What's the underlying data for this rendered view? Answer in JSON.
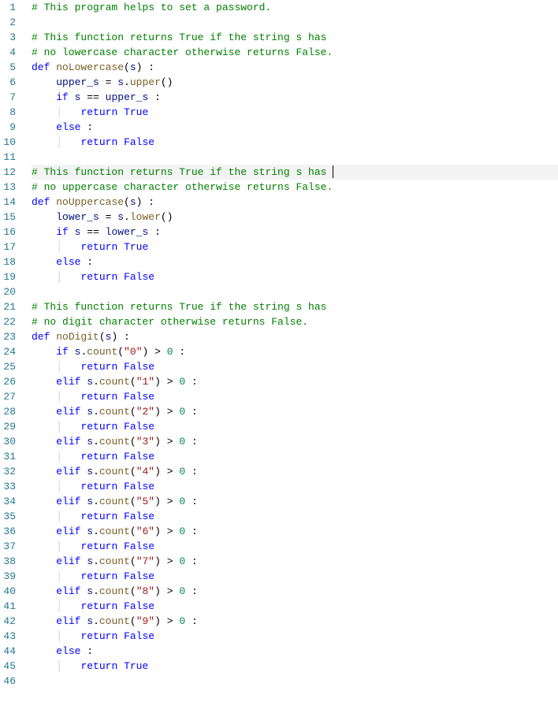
{
  "lines": [
    {
      "num": "1",
      "tokens": [
        {
          "t": "# This program helps to set a password.",
          "c": "comment"
        }
      ]
    },
    {
      "num": "2",
      "tokens": []
    },
    {
      "num": "3",
      "tokens": [
        {
          "t": "# This function returns True if the string s has",
          "c": "comment"
        }
      ]
    },
    {
      "num": "4",
      "tokens": [
        {
          "t": "# no lowercase character otherwise returns False.",
          "c": "comment"
        }
      ]
    },
    {
      "num": "5",
      "tokens": [
        {
          "t": "def ",
          "c": "keyword"
        },
        {
          "t": "noLowercase",
          "c": "funcdef"
        },
        {
          "t": "(",
          "c": ""
        },
        {
          "t": "s",
          "c": "ident"
        },
        {
          "t": ") :",
          "c": ""
        }
      ]
    },
    {
      "num": "6",
      "tokens": [
        {
          "t": "    ",
          "c": ""
        },
        {
          "t": "upper_s",
          "c": "ident"
        },
        {
          "t": " = ",
          "c": ""
        },
        {
          "t": "s",
          "c": "ident"
        },
        {
          "t": ".",
          "c": ""
        },
        {
          "t": "upper",
          "c": "funccall"
        },
        {
          "t": "()",
          "c": ""
        }
      ]
    },
    {
      "num": "7",
      "tokens": [
        {
          "t": "    ",
          "c": ""
        },
        {
          "t": "if",
          "c": "keyword"
        },
        {
          "t": " ",
          "c": ""
        },
        {
          "t": "s",
          "c": "ident"
        },
        {
          "t": " == ",
          "c": ""
        },
        {
          "t": "upper_s",
          "c": "ident"
        },
        {
          "t": " :",
          "c": ""
        }
      ]
    },
    {
      "num": "8",
      "tokens": [
        {
          "t": "    ",
          "c": ""
        },
        {
          "t": "│   ",
          "c": "guide"
        },
        {
          "t": "return",
          "c": "keyword"
        },
        {
          "t": " ",
          "c": ""
        },
        {
          "t": "True",
          "c": "const"
        }
      ]
    },
    {
      "num": "9",
      "tokens": [
        {
          "t": "    ",
          "c": ""
        },
        {
          "t": "else",
          "c": "keyword"
        },
        {
          "t": " :",
          "c": ""
        }
      ]
    },
    {
      "num": "10",
      "tokens": [
        {
          "t": "    ",
          "c": ""
        },
        {
          "t": "│   ",
          "c": "guide"
        },
        {
          "t": "return",
          "c": "keyword"
        },
        {
          "t": " ",
          "c": ""
        },
        {
          "t": "False",
          "c": "const"
        }
      ]
    },
    {
      "num": "11",
      "tokens": []
    },
    {
      "num": "12",
      "highlighted": true,
      "cursor": true,
      "tokens": [
        {
          "t": "# This function returns True if the string s has ",
          "c": "comment"
        }
      ]
    },
    {
      "num": "13",
      "tokens": [
        {
          "t": "# no uppercase character otherwise returns False.",
          "c": "comment"
        }
      ]
    },
    {
      "num": "14",
      "tokens": [
        {
          "t": "def ",
          "c": "keyword"
        },
        {
          "t": "noUppercase",
          "c": "funcdef"
        },
        {
          "t": "(",
          "c": ""
        },
        {
          "t": "s",
          "c": "ident"
        },
        {
          "t": ") :",
          "c": ""
        }
      ]
    },
    {
      "num": "15",
      "tokens": [
        {
          "t": "    ",
          "c": ""
        },
        {
          "t": "lower_s",
          "c": "ident"
        },
        {
          "t": " = ",
          "c": ""
        },
        {
          "t": "s",
          "c": "ident"
        },
        {
          "t": ".",
          "c": ""
        },
        {
          "t": "lower",
          "c": "funccall"
        },
        {
          "t": "()",
          "c": ""
        }
      ]
    },
    {
      "num": "16",
      "tokens": [
        {
          "t": "    ",
          "c": ""
        },
        {
          "t": "if",
          "c": "keyword"
        },
        {
          "t": " ",
          "c": ""
        },
        {
          "t": "s",
          "c": "ident"
        },
        {
          "t": " == ",
          "c": ""
        },
        {
          "t": "lower_s",
          "c": "ident"
        },
        {
          "t": " :",
          "c": ""
        }
      ]
    },
    {
      "num": "17",
      "tokens": [
        {
          "t": "    ",
          "c": ""
        },
        {
          "t": "│   ",
          "c": "guide"
        },
        {
          "t": "return",
          "c": "keyword"
        },
        {
          "t": " ",
          "c": ""
        },
        {
          "t": "True",
          "c": "const"
        }
      ]
    },
    {
      "num": "18",
      "tokens": [
        {
          "t": "    ",
          "c": ""
        },
        {
          "t": "else",
          "c": "keyword"
        },
        {
          "t": " :",
          "c": ""
        }
      ]
    },
    {
      "num": "19",
      "tokens": [
        {
          "t": "    ",
          "c": ""
        },
        {
          "t": "│   ",
          "c": "guide"
        },
        {
          "t": "return",
          "c": "keyword"
        },
        {
          "t": " ",
          "c": ""
        },
        {
          "t": "False",
          "c": "const"
        }
      ]
    },
    {
      "num": "20",
      "tokens": []
    },
    {
      "num": "21",
      "tokens": [
        {
          "t": "# This function returns True if the string s has",
          "c": "comment"
        }
      ]
    },
    {
      "num": "22",
      "tokens": [
        {
          "t": "# no digit character otherwise returns False.",
          "c": "comment"
        }
      ]
    },
    {
      "num": "23",
      "tokens": [
        {
          "t": "def ",
          "c": "keyword"
        },
        {
          "t": "noDigit",
          "c": "funcdef"
        },
        {
          "t": "(",
          "c": ""
        },
        {
          "t": "s",
          "c": "ident"
        },
        {
          "t": ") :",
          "c": ""
        }
      ]
    },
    {
      "num": "24",
      "tokens": [
        {
          "t": "    ",
          "c": ""
        },
        {
          "t": "if",
          "c": "keyword"
        },
        {
          "t": " ",
          "c": ""
        },
        {
          "t": "s",
          "c": "ident"
        },
        {
          "t": ".",
          "c": ""
        },
        {
          "t": "count",
          "c": "funccall"
        },
        {
          "t": "(",
          "c": ""
        },
        {
          "t": "\"0\"",
          "c": "string"
        },
        {
          "t": ") > ",
          "c": ""
        },
        {
          "t": "0",
          "c": "number"
        },
        {
          "t": " :",
          "c": ""
        }
      ]
    },
    {
      "num": "25",
      "tokens": [
        {
          "t": "    ",
          "c": ""
        },
        {
          "t": "│   ",
          "c": "guide"
        },
        {
          "t": "return",
          "c": "keyword"
        },
        {
          "t": " ",
          "c": ""
        },
        {
          "t": "False",
          "c": "const"
        }
      ]
    },
    {
      "num": "26",
      "tokens": [
        {
          "t": "    ",
          "c": ""
        },
        {
          "t": "elif",
          "c": "keyword"
        },
        {
          "t": " ",
          "c": ""
        },
        {
          "t": "s",
          "c": "ident"
        },
        {
          "t": ".",
          "c": ""
        },
        {
          "t": "count",
          "c": "funccall"
        },
        {
          "t": "(",
          "c": ""
        },
        {
          "t": "\"1\"",
          "c": "string"
        },
        {
          "t": ") > ",
          "c": ""
        },
        {
          "t": "0",
          "c": "number"
        },
        {
          "t": " :",
          "c": ""
        }
      ]
    },
    {
      "num": "27",
      "tokens": [
        {
          "t": "    ",
          "c": ""
        },
        {
          "t": "│   ",
          "c": "guide"
        },
        {
          "t": "return",
          "c": "keyword"
        },
        {
          "t": " ",
          "c": ""
        },
        {
          "t": "False",
          "c": "const"
        }
      ]
    },
    {
      "num": "28",
      "tokens": [
        {
          "t": "    ",
          "c": ""
        },
        {
          "t": "elif",
          "c": "keyword"
        },
        {
          "t": " ",
          "c": ""
        },
        {
          "t": "s",
          "c": "ident"
        },
        {
          "t": ".",
          "c": ""
        },
        {
          "t": "count",
          "c": "funccall"
        },
        {
          "t": "(",
          "c": ""
        },
        {
          "t": "\"2\"",
          "c": "string"
        },
        {
          "t": ") > ",
          "c": ""
        },
        {
          "t": "0",
          "c": "number"
        },
        {
          "t": " :",
          "c": ""
        }
      ]
    },
    {
      "num": "29",
      "tokens": [
        {
          "t": "    ",
          "c": ""
        },
        {
          "t": "│   ",
          "c": "guide"
        },
        {
          "t": "return",
          "c": "keyword"
        },
        {
          "t": " ",
          "c": ""
        },
        {
          "t": "False",
          "c": "const"
        }
      ]
    },
    {
      "num": "30",
      "tokens": [
        {
          "t": "    ",
          "c": ""
        },
        {
          "t": "elif",
          "c": "keyword"
        },
        {
          "t": " ",
          "c": ""
        },
        {
          "t": "s",
          "c": "ident"
        },
        {
          "t": ".",
          "c": ""
        },
        {
          "t": "count",
          "c": "funccall"
        },
        {
          "t": "(",
          "c": ""
        },
        {
          "t": "\"3\"",
          "c": "string"
        },
        {
          "t": ") > ",
          "c": ""
        },
        {
          "t": "0",
          "c": "number"
        },
        {
          "t": " :",
          "c": ""
        }
      ]
    },
    {
      "num": "31",
      "tokens": [
        {
          "t": "    ",
          "c": ""
        },
        {
          "t": "│   ",
          "c": "guide"
        },
        {
          "t": "return",
          "c": "keyword"
        },
        {
          "t": " ",
          "c": ""
        },
        {
          "t": "False",
          "c": "const"
        }
      ]
    },
    {
      "num": "32",
      "tokens": [
        {
          "t": "    ",
          "c": ""
        },
        {
          "t": "elif",
          "c": "keyword"
        },
        {
          "t": " ",
          "c": ""
        },
        {
          "t": "s",
          "c": "ident"
        },
        {
          "t": ".",
          "c": ""
        },
        {
          "t": "count",
          "c": "funccall"
        },
        {
          "t": "(",
          "c": ""
        },
        {
          "t": "\"4\"",
          "c": "string"
        },
        {
          "t": ") > ",
          "c": ""
        },
        {
          "t": "0",
          "c": "number"
        },
        {
          "t": " :",
          "c": ""
        }
      ]
    },
    {
      "num": "33",
      "tokens": [
        {
          "t": "    ",
          "c": ""
        },
        {
          "t": "│   ",
          "c": "guide"
        },
        {
          "t": "return",
          "c": "keyword"
        },
        {
          "t": " ",
          "c": ""
        },
        {
          "t": "False",
          "c": "const"
        }
      ]
    },
    {
      "num": "34",
      "tokens": [
        {
          "t": "    ",
          "c": ""
        },
        {
          "t": "elif",
          "c": "keyword"
        },
        {
          "t": " ",
          "c": ""
        },
        {
          "t": "s",
          "c": "ident"
        },
        {
          "t": ".",
          "c": ""
        },
        {
          "t": "count",
          "c": "funccall"
        },
        {
          "t": "(",
          "c": ""
        },
        {
          "t": "\"5\"",
          "c": "string"
        },
        {
          "t": ") > ",
          "c": ""
        },
        {
          "t": "0",
          "c": "number"
        },
        {
          "t": " :",
          "c": ""
        }
      ]
    },
    {
      "num": "35",
      "tokens": [
        {
          "t": "    ",
          "c": ""
        },
        {
          "t": "│   ",
          "c": "guide"
        },
        {
          "t": "return",
          "c": "keyword"
        },
        {
          "t": " ",
          "c": ""
        },
        {
          "t": "False",
          "c": "const"
        }
      ]
    },
    {
      "num": "36",
      "tokens": [
        {
          "t": "    ",
          "c": ""
        },
        {
          "t": "elif",
          "c": "keyword"
        },
        {
          "t": " ",
          "c": ""
        },
        {
          "t": "s",
          "c": "ident"
        },
        {
          "t": ".",
          "c": ""
        },
        {
          "t": "count",
          "c": "funccall"
        },
        {
          "t": "(",
          "c": ""
        },
        {
          "t": "\"6\"",
          "c": "string"
        },
        {
          "t": ") > ",
          "c": ""
        },
        {
          "t": "0",
          "c": "number"
        },
        {
          "t": " :",
          "c": ""
        }
      ]
    },
    {
      "num": "37",
      "tokens": [
        {
          "t": "    ",
          "c": ""
        },
        {
          "t": "│   ",
          "c": "guide"
        },
        {
          "t": "return",
          "c": "keyword"
        },
        {
          "t": " ",
          "c": ""
        },
        {
          "t": "False",
          "c": "const"
        }
      ]
    },
    {
      "num": "38",
      "tokens": [
        {
          "t": "    ",
          "c": ""
        },
        {
          "t": "elif",
          "c": "keyword"
        },
        {
          "t": " ",
          "c": ""
        },
        {
          "t": "s",
          "c": "ident"
        },
        {
          "t": ".",
          "c": ""
        },
        {
          "t": "count",
          "c": "funccall"
        },
        {
          "t": "(",
          "c": ""
        },
        {
          "t": "\"7\"",
          "c": "string"
        },
        {
          "t": ") > ",
          "c": ""
        },
        {
          "t": "0",
          "c": "number"
        },
        {
          "t": " :",
          "c": ""
        }
      ]
    },
    {
      "num": "39",
      "tokens": [
        {
          "t": "    ",
          "c": ""
        },
        {
          "t": "│   ",
          "c": "guide"
        },
        {
          "t": "return",
          "c": "keyword"
        },
        {
          "t": " ",
          "c": ""
        },
        {
          "t": "False",
          "c": "const"
        }
      ]
    },
    {
      "num": "40",
      "tokens": [
        {
          "t": "    ",
          "c": ""
        },
        {
          "t": "elif",
          "c": "keyword"
        },
        {
          "t": " ",
          "c": ""
        },
        {
          "t": "s",
          "c": "ident"
        },
        {
          "t": ".",
          "c": ""
        },
        {
          "t": "count",
          "c": "funccall"
        },
        {
          "t": "(",
          "c": ""
        },
        {
          "t": "\"8\"",
          "c": "string"
        },
        {
          "t": ") > ",
          "c": ""
        },
        {
          "t": "0",
          "c": "number"
        },
        {
          "t": " :",
          "c": ""
        }
      ]
    },
    {
      "num": "41",
      "tokens": [
        {
          "t": "    ",
          "c": ""
        },
        {
          "t": "│   ",
          "c": "guide"
        },
        {
          "t": "return",
          "c": "keyword"
        },
        {
          "t": " ",
          "c": ""
        },
        {
          "t": "False",
          "c": "const"
        }
      ]
    },
    {
      "num": "42",
      "tokens": [
        {
          "t": "    ",
          "c": ""
        },
        {
          "t": "elif",
          "c": "keyword"
        },
        {
          "t": " ",
          "c": ""
        },
        {
          "t": "s",
          "c": "ident"
        },
        {
          "t": ".",
          "c": ""
        },
        {
          "t": "count",
          "c": "funccall"
        },
        {
          "t": "(",
          "c": ""
        },
        {
          "t": "\"9\"",
          "c": "string"
        },
        {
          "t": ") > ",
          "c": ""
        },
        {
          "t": "0",
          "c": "number"
        },
        {
          "t": " :",
          "c": ""
        }
      ]
    },
    {
      "num": "43",
      "tokens": [
        {
          "t": "    ",
          "c": ""
        },
        {
          "t": "│   ",
          "c": "guide"
        },
        {
          "t": "return",
          "c": "keyword"
        },
        {
          "t": " ",
          "c": ""
        },
        {
          "t": "False",
          "c": "const"
        }
      ]
    },
    {
      "num": "44",
      "tokens": [
        {
          "t": "    ",
          "c": ""
        },
        {
          "t": "else",
          "c": "keyword"
        },
        {
          "t": " :",
          "c": ""
        }
      ]
    },
    {
      "num": "45",
      "tokens": [
        {
          "t": "    ",
          "c": ""
        },
        {
          "t": "│   ",
          "c": "guide"
        },
        {
          "t": "return",
          "c": "keyword"
        },
        {
          "t": " ",
          "c": ""
        },
        {
          "t": "True",
          "c": "const"
        }
      ]
    },
    {
      "num": "46",
      "tokens": []
    }
  ]
}
